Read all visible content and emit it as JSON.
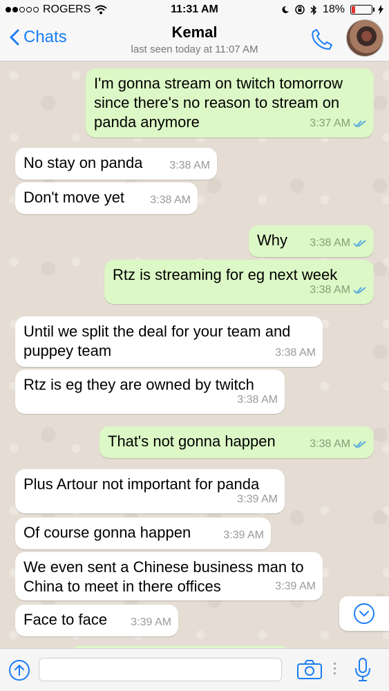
{
  "status": {
    "carrier": "ROGERS",
    "time": "11:31 AM",
    "battery": "18%"
  },
  "header": {
    "back_label": "Chats",
    "contact_name": "Kemal",
    "last_seen": "last seen today at 11:07 AM"
  },
  "messages": [
    {
      "dir": "out",
      "text": "I'm gonna stream on twitch tomorrow since there's no reason to stream on panda anymore",
      "time": "3:37 AM",
      "read": true
    },
    {
      "dir": "in",
      "text": "No stay on panda",
      "time": "3:38 AM"
    },
    {
      "dir": "in",
      "text": "Don't move yet",
      "time": "3:38 AM"
    },
    {
      "dir": "out",
      "text": "Why",
      "time": "3:38 AM",
      "read": true
    },
    {
      "dir": "out",
      "text": "Rtz is streaming for eg next week",
      "time": "3:38 AM",
      "read": true
    },
    {
      "dir": "in",
      "text": "Until we split the deal for your team and puppey team",
      "time": "3:38 AM"
    },
    {
      "dir": "in",
      "text": "Rtz is eg they are owned by twitch",
      "time": "3:38 AM"
    },
    {
      "dir": "out",
      "text": "That's not gonna happen",
      "time": "3:38 AM",
      "read": true
    },
    {
      "dir": "in",
      "text": "Plus Artour not important for panda",
      "time": "3:39 AM"
    },
    {
      "dir": "in",
      "text": "Of course gonna happen",
      "time": "3:39 AM"
    },
    {
      "dir": "in",
      "text": "We even sent a Chinese business man to China to meet in there offices",
      "time": "3:39 AM"
    },
    {
      "dir": "in",
      "text": "Face to face",
      "time": "3:39 AM"
    }
  ],
  "composer": {
    "value": "",
    "placeholder": ""
  },
  "colors": {
    "accent": "#1a7cf5",
    "outgoing_bubble": "#dcf8c6",
    "incoming_bubble": "#ffffff",
    "read_ticks": "#4fa3e3"
  }
}
